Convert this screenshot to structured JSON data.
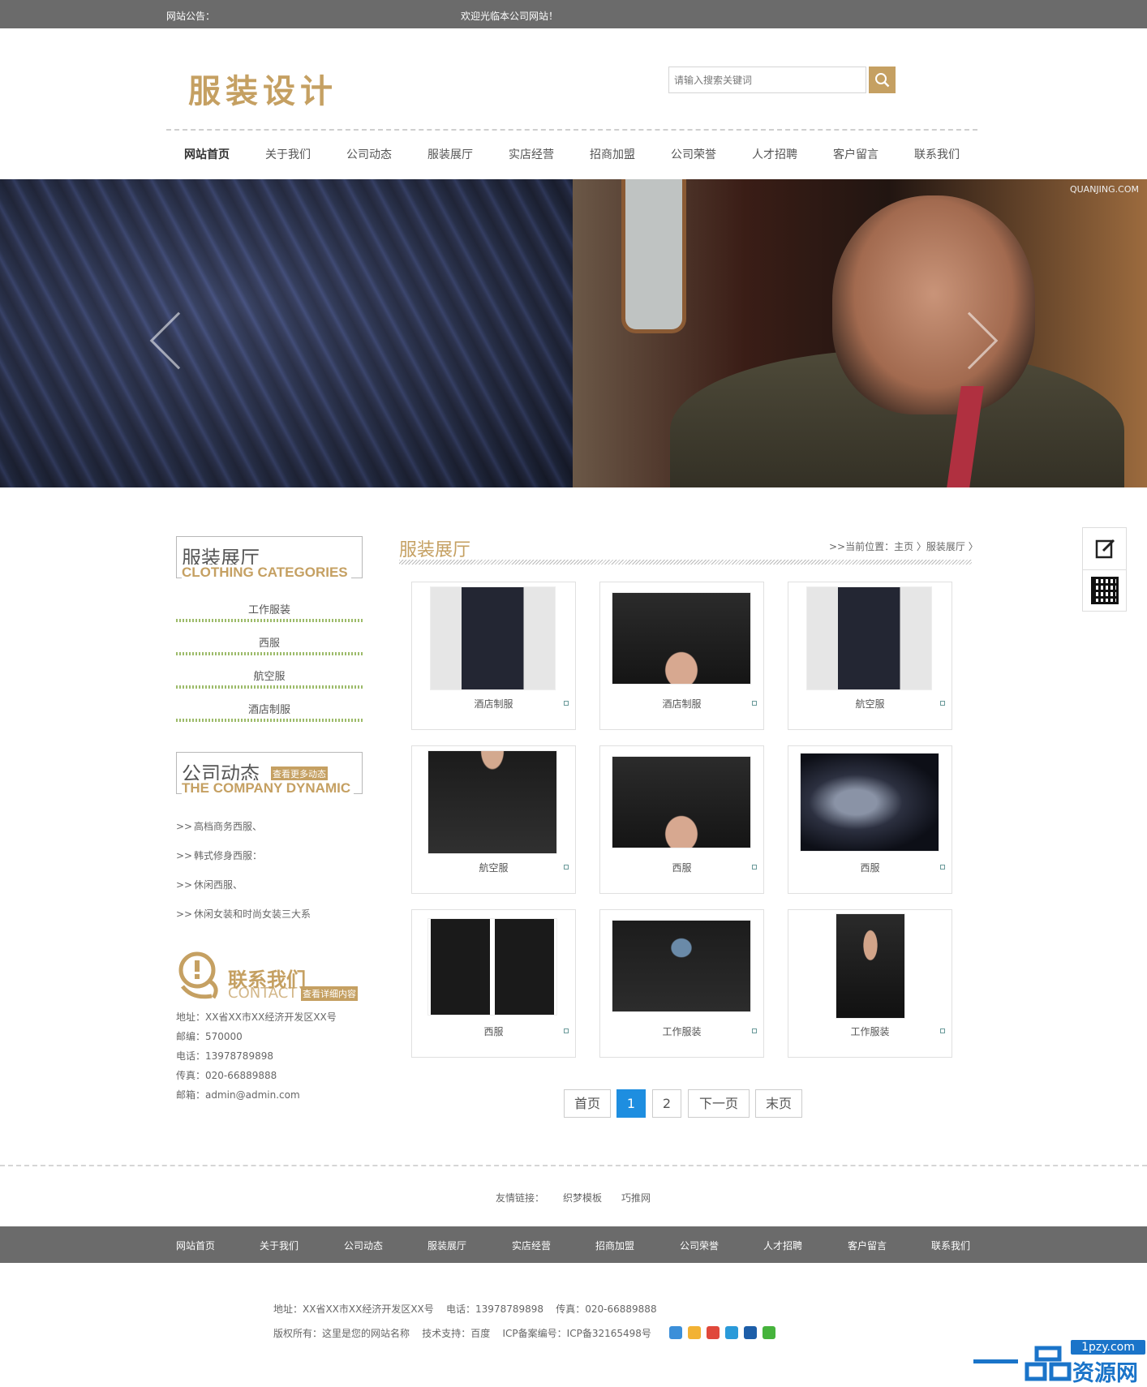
{
  "topbar": {
    "notice_label": "网站公告：",
    "notice_text": "欢迎光临本公司网站！"
  },
  "logo": {
    "text": "服装设计"
  },
  "search": {
    "placeholder": "请输入搜索关键词"
  },
  "nav": {
    "items": [
      "网站首页",
      "关于我们",
      "公司动态",
      "服装展厅",
      "实店经营",
      "招商加盟",
      "公司荣誉",
      "人才招聘",
      "客户留言",
      "联系我们"
    ]
  },
  "banner": {
    "watermark": "QUANJING.COM"
  },
  "sidebar": {
    "categories": {
      "title_cn": "服装展厅",
      "title_en": "CLOTHING CATEGORIES",
      "items": [
        "工作服装",
        "西服",
        "航空服",
        "酒店制服"
      ]
    },
    "news": {
      "title_cn": "公司动态",
      "title_en": "THE COMPANY DYNAMIC",
      "more": "查看更多动态",
      "chevron": ">>",
      "items": [
        "高档商务西服、",
        "韩式修身西服：",
        "休闲西服、",
        "休闲女装和时尚女装三大系"
      ]
    },
    "contact": {
      "title_cn": "联系我们",
      "title_en": "CONTACT",
      "more": "查看详细内容",
      "lines": [
        "地址：XX省XX市XX经济开发区XX号",
        "邮编：570000",
        "电话：13978789898",
        "传真：020-66889888",
        "邮箱：admin@admin.com"
      ]
    }
  },
  "main": {
    "title": "服装展厅",
    "breadcrumb": ">>当前位置：主页 〉服装展厅 〉",
    "products": [
      {
        "label": "酒店制服"
      },
      {
        "label": "酒店制服"
      },
      {
        "label": "航空服"
      },
      {
        "label": "航空服"
      },
      {
        "label": "西服"
      },
      {
        "label": "西服"
      },
      {
        "label": "西服"
      },
      {
        "label": "工作服装"
      },
      {
        "label": "工作服装"
      }
    ],
    "pagination": {
      "first": "首页",
      "page1": "1",
      "page2": "2",
      "next": "下一页",
      "last": "末页"
    }
  },
  "friend_links": {
    "label": "友情链接：",
    "links": [
      "织梦模板",
      "巧推网"
    ]
  },
  "footer_nav": {
    "items": [
      "网站首页",
      "关于我们",
      "公司动态",
      "服装展厅",
      "实店经营",
      "招商加盟",
      "公司荣誉",
      "人才招聘",
      "客户留言",
      "联系我们"
    ]
  },
  "footer_info": {
    "line1": "地址：XX省XX市XX经济开发区XX号    电话：13978789898    传真：020-66889888",
    "line2": "版权所有：这里是您的网站名称    技术支持：百度    ICP备案编号：ICP备32165498号"
  },
  "brandmark": {
    "url": "1pzy.com",
    "text": "资源网"
  },
  "colors": {
    "accent": "#c5a062",
    "topbar": "#6b6b6b",
    "pager_active": "#1e8ee0",
    "brand_blue": "#1a74c9"
  }
}
